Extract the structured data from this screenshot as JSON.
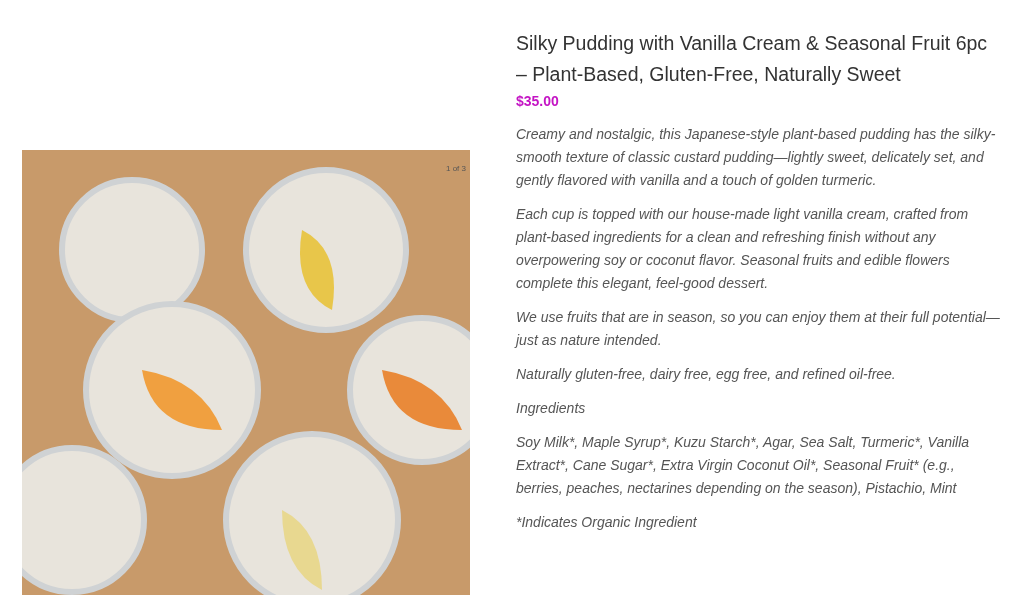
{
  "gallery": {
    "counter": "1 of 3"
  },
  "product": {
    "title": "Silky Pudding with Vanilla Cream & Seasonal Fruit 6pc – Plant-Based, Gluten-Free, Naturally Sweet",
    "price": "$35.00",
    "description": [
      "Creamy and nostalgic, this Japanese-style plant-based pudding has the silky-smooth texture of classic custard pudding—lightly sweet, delicately set, and gently flavored with vanilla and a touch of golden turmeric.",
      "Each cup is topped with our house-made light vanilla cream, crafted from plant-based ingredients for a clean and refreshing finish without any overpowering soy or coconut flavor. Seasonal fruits and edible flowers complete this elegant, feel-good dessert.",
      "We use fruits that are in season, so you can enjoy them at their full potential—just as nature intended.",
      "Naturally gluten-free, dairy free, egg free, and refined oil-free.",
      "Ingredients",
      "Soy Milk*, Maple Syrup*, Kuzu Starch*, Agar, Sea Salt, Turmeric*, Vanilla Extract*, Cane Sugar*, Extra Virgin Coconut Oil*, Seasonal Fruit* (e.g., berries, peaches, nectarines depending on the season), Pistachio, Mint",
      "*Indicates Organic Ingredient"
    ]
  }
}
